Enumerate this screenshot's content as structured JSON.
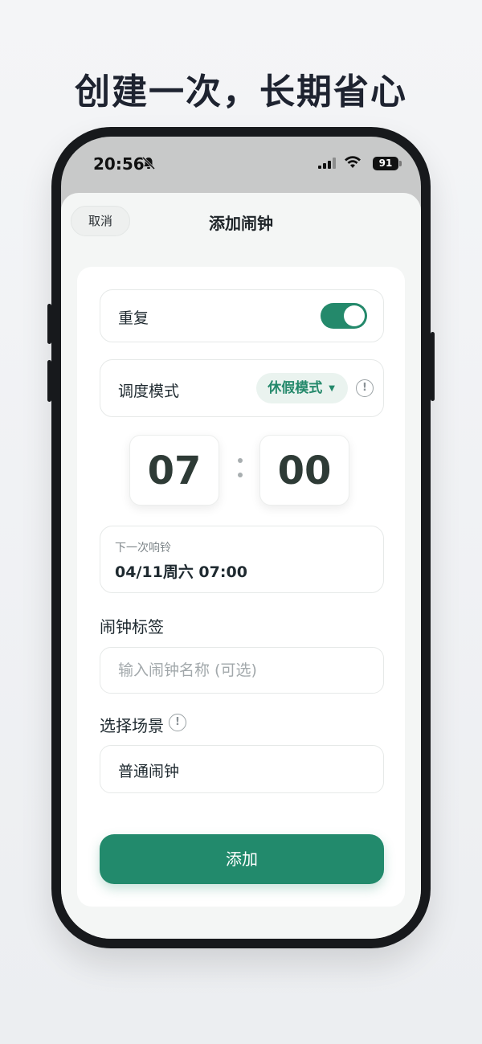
{
  "headline": "创建一次，长期省心",
  "status_bar": {
    "time": "20:56",
    "battery": "91",
    "icons": [
      "bell-muted-icon",
      "cellular-signal-icon",
      "wifi-icon",
      "battery-icon"
    ]
  },
  "header": {
    "cancel_label": "取消",
    "title": "添加闹钟"
  },
  "repeat": {
    "label": "重复",
    "enabled": true
  },
  "schedule_mode": {
    "label": "调度模式",
    "selected": "休假模式",
    "info_icon": "info-icon"
  },
  "time": {
    "hour": "07",
    "minute": "00"
  },
  "next_ring": {
    "label": "下一次响铃",
    "value": "04/11周六 07:00"
  },
  "alarm_label": {
    "label": "闹钟标签",
    "placeholder": "输入闹钟名称 (可选)",
    "value": ""
  },
  "scene": {
    "label": "选择场景",
    "selected": "普通闹钟"
  },
  "add_button_label": "添加",
  "colors": {
    "accent": "#228a6c",
    "accent_light": "#eaf3ef",
    "background": "#f4f5f7"
  }
}
